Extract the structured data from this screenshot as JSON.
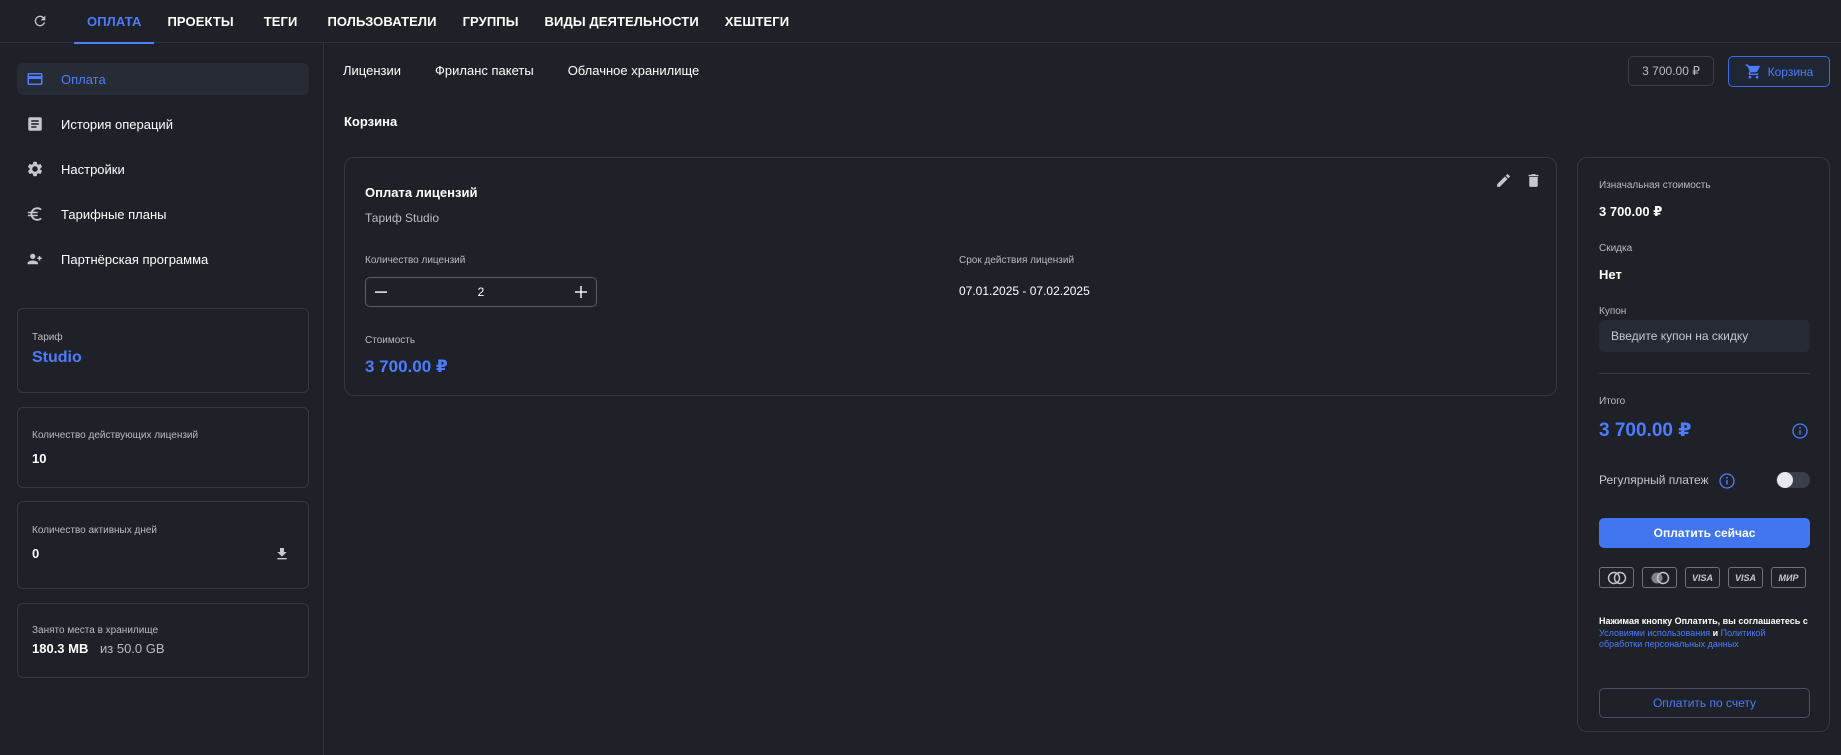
{
  "topnav": {
    "tabs": [
      {
        "label": "ОПЛАТА",
        "active": true
      },
      {
        "label": "ПРОЕКТЫ"
      },
      {
        "label": "ТЕГИ"
      },
      {
        "label": "ПОЛЬЗОВАТЕЛИ"
      },
      {
        "label": "ГРУППЫ"
      },
      {
        "label": "ВИДЫ ДЕЯТЕЛЬНОСТИ"
      },
      {
        "label": "ХЕШТЕГИ"
      }
    ]
  },
  "sidebar": {
    "items": [
      {
        "label": "Оплата",
        "icon": "credit-card-icon",
        "active": true
      },
      {
        "label": "История операций",
        "icon": "receipt-icon"
      },
      {
        "label": "Настройки",
        "icon": "gear-icon"
      },
      {
        "label": "Тарифные планы",
        "icon": "euro-icon"
      },
      {
        "label": "Партнёрская программа",
        "icon": "partner-icon"
      }
    ],
    "plan": {
      "caption": "Тариф",
      "value": "Studio"
    },
    "licenses": {
      "caption": "Количество действующих лицензий",
      "value": "10"
    },
    "active_days": {
      "caption": "Количество активных дней",
      "value": "0"
    },
    "storage": {
      "caption": "Занято места в хранилище",
      "used": "180.3 MB",
      "total": "из 50.0 GB"
    }
  },
  "main": {
    "subtabs": [
      "Лицензии",
      "Фриланс пакеты",
      "Облачное хранилище"
    ],
    "price_chip": "3 700.00 ₽",
    "cart_label": "Корзина",
    "section_title": "Корзина",
    "license_card": {
      "title": "Оплата лицензий",
      "subtitle": "Тариф Studio",
      "qty_caption": "Количество лицензий",
      "qty_value": "2",
      "period_caption": "Срок действия лицензий",
      "period_value": "07.01.2025 - 07.02.2025",
      "cost_caption": "Стоимость",
      "cost_value": "3 700.00 ₽"
    }
  },
  "summary": {
    "initial_caption": "Изначальная стоимость",
    "initial_value": "3 700.00 ₽",
    "discount_caption": "Скидка",
    "discount_value": "Нет",
    "coupon_caption": "Купон",
    "coupon_placeholder": "Введите купон на скидку",
    "total_caption": "Итого",
    "total_value": "3 700.00 ₽",
    "recurring_label": "Регулярный платеж",
    "recurring_enabled": false,
    "pay_now_label": "Оплатить сейчас",
    "payment_cards": [
      "mastercard",
      "maestro",
      "VISA",
      "VISA",
      "МИР"
    ],
    "terms_text_1": "Нажимая кнопку Оплатить, вы соглашаетесь с ",
    "terms_link_1": "Условиями использования",
    "terms_text_2": " и ",
    "terms_link_2": "Политикой обработки персональных данных",
    "pay_invoice_label": "Оплатить по счету"
  },
  "colors": {
    "background": "#1e2128",
    "accent": "#4d7cff",
    "border": "#343841",
    "muted_text": "#b9bcc4"
  }
}
